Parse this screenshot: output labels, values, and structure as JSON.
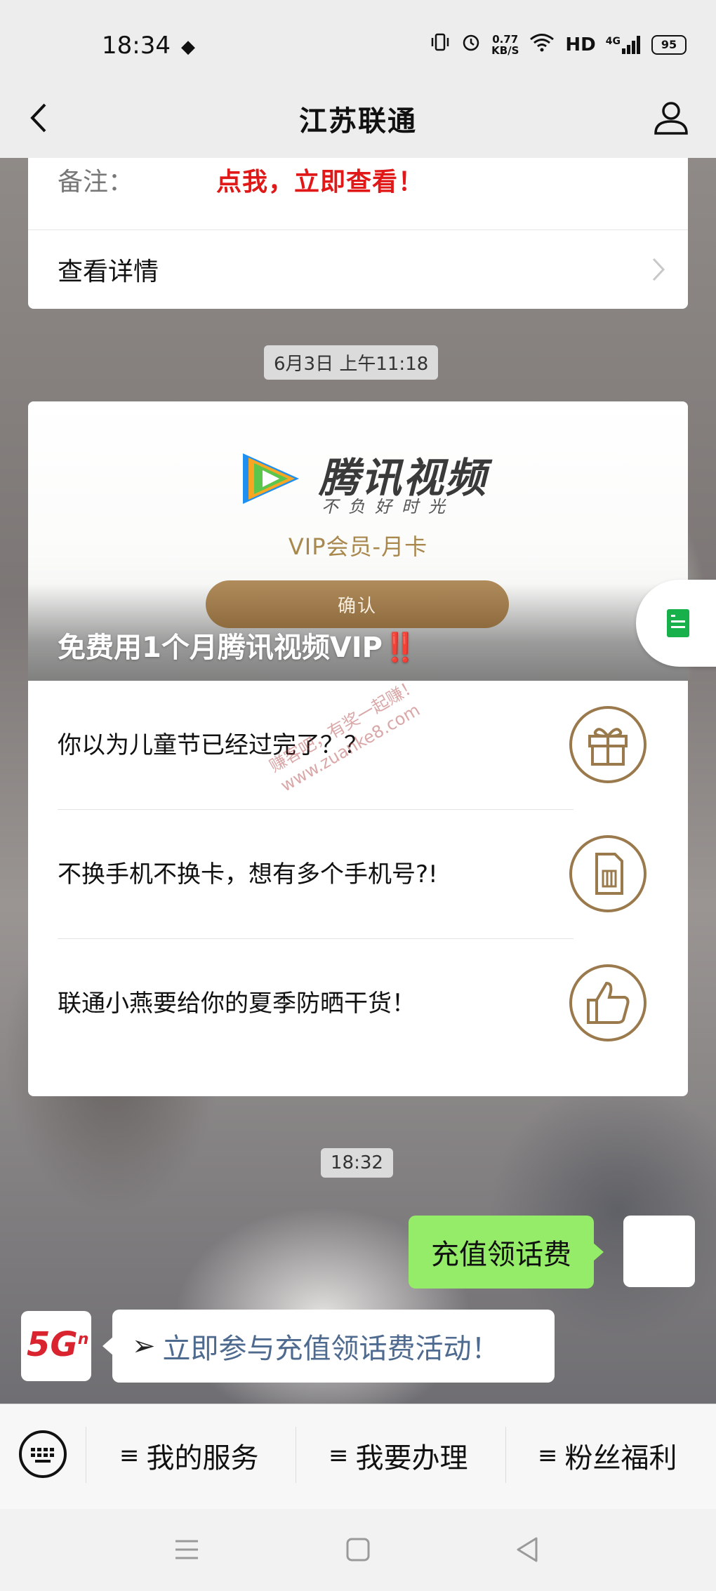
{
  "status_bar": {
    "time": "18:34",
    "net_speed_value": "0.77",
    "net_speed_unit": "KB/S",
    "hd": "HD",
    "signal": "4G",
    "battery": "95"
  },
  "header": {
    "title": "江苏联通"
  },
  "top_card": {
    "remark_label": "备注：",
    "remark_value": "点我，立即查看！",
    "detail_label": "查看详情"
  },
  "timestamps": {
    "first": "6月3日 上午11:18",
    "second": "18:32"
  },
  "promo_card": {
    "brand_name": "腾讯视频",
    "brand_slogan": "不负好时光",
    "vip_label": "VIP会员-月卡",
    "confirm_label": "确认",
    "title": "免费用1个月腾讯视频VIP",
    "title_emoji": "‼️",
    "items": [
      {
        "text": "你以为儿童节已经过完了？？",
        "icon": "gift-icon"
      },
      {
        "text": "不换手机不换卡，想有多个手机号?!",
        "icon": "sim-card-icon"
      },
      {
        "text": "联通小燕要给你的夏季防晒干货！",
        "icon": "thumbs-up-icon"
      }
    ]
  },
  "watermark": {
    "line1": "赚客吧，有奖一起赚！",
    "line2": "www.zuanke8.com"
  },
  "messages": {
    "outgoing": "充值领话费",
    "incoming_arrow": "➢",
    "incoming": "立即参与充值领话费活动！",
    "brand_avatar": "5G",
    "brand_avatar_sup": "n"
  },
  "bottom_menu": {
    "prefix": "≡",
    "items": [
      "我的服务",
      "我要办理",
      "粉丝福利"
    ]
  },
  "colors": {
    "accent_red": "#e01818",
    "bubble_green": "#95ec69",
    "gold": "#a8884d"
  }
}
